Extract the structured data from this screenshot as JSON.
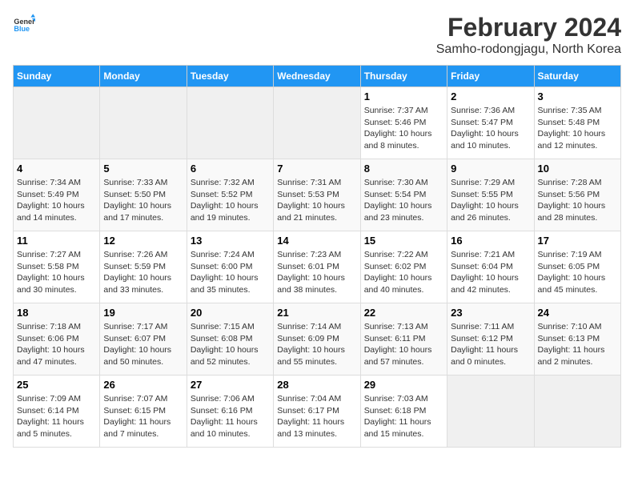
{
  "logo": {
    "text_general": "General",
    "text_blue": "Blue"
  },
  "title": "February 2024",
  "subtitle": "Samho-rodongjagu, North Korea",
  "days_of_week": [
    "Sunday",
    "Monday",
    "Tuesday",
    "Wednesday",
    "Thursday",
    "Friday",
    "Saturday"
  ],
  "weeks": [
    [
      {
        "day": "",
        "content": ""
      },
      {
        "day": "",
        "content": ""
      },
      {
        "day": "",
        "content": ""
      },
      {
        "day": "",
        "content": ""
      },
      {
        "day": "1",
        "content": "Sunrise: 7:37 AM\nSunset: 5:46 PM\nDaylight: 10 hours and 8 minutes."
      },
      {
        "day": "2",
        "content": "Sunrise: 7:36 AM\nSunset: 5:47 PM\nDaylight: 10 hours and 10 minutes."
      },
      {
        "day": "3",
        "content": "Sunrise: 7:35 AM\nSunset: 5:48 PM\nDaylight: 10 hours and 12 minutes."
      }
    ],
    [
      {
        "day": "4",
        "content": "Sunrise: 7:34 AM\nSunset: 5:49 PM\nDaylight: 10 hours and 14 minutes."
      },
      {
        "day": "5",
        "content": "Sunrise: 7:33 AM\nSunset: 5:50 PM\nDaylight: 10 hours and 17 minutes."
      },
      {
        "day": "6",
        "content": "Sunrise: 7:32 AM\nSunset: 5:52 PM\nDaylight: 10 hours and 19 minutes."
      },
      {
        "day": "7",
        "content": "Sunrise: 7:31 AM\nSunset: 5:53 PM\nDaylight: 10 hours and 21 minutes."
      },
      {
        "day": "8",
        "content": "Sunrise: 7:30 AM\nSunset: 5:54 PM\nDaylight: 10 hours and 23 minutes."
      },
      {
        "day": "9",
        "content": "Sunrise: 7:29 AM\nSunset: 5:55 PM\nDaylight: 10 hours and 26 minutes."
      },
      {
        "day": "10",
        "content": "Sunrise: 7:28 AM\nSunset: 5:56 PM\nDaylight: 10 hours and 28 minutes."
      }
    ],
    [
      {
        "day": "11",
        "content": "Sunrise: 7:27 AM\nSunset: 5:58 PM\nDaylight: 10 hours and 30 minutes."
      },
      {
        "day": "12",
        "content": "Sunrise: 7:26 AM\nSunset: 5:59 PM\nDaylight: 10 hours and 33 minutes."
      },
      {
        "day": "13",
        "content": "Sunrise: 7:24 AM\nSunset: 6:00 PM\nDaylight: 10 hours and 35 minutes."
      },
      {
        "day": "14",
        "content": "Sunrise: 7:23 AM\nSunset: 6:01 PM\nDaylight: 10 hours and 38 minutes."
      },
      {
        "day": "15",
        "content": "Sunrise: 7:22 AM\nSunset: 6:02 PM\nDaylight: 10 hours and 40 minutes."
      },
      {
        "day": "16",
        "content": "Sunrise: 7:21 AM\nSunset: 6:04 PM\nDaylight: 10 hours and 42 minutes."
      },
      {
        "day": "17",
        "content": "Sunrise: 7:19 AM\nSunset: 6:05 PM\nDaylight: 10 hours and 45 minutes."
      }
    ],
    [
      {
        "day": "18",
        "content": "Sunrise: 7:18 AM\nSunset: 6:06 PM\nDaylight: 10 hours and 47 minutes."
      },
      {
        "day": "19",
        "content": "Sunrise: 7:17 AM\nSunset: 6:07 PM\nDaylight: 10 hours and 50 minutes."
      },
      {
        "day": "20",
        "content": "Sunrise: 7:15 AM\nSunset: 6:08 PM\nDaylight: 10 hours and 52 minutes."
      },
      {
        "day": "21",
        "content": "Sunrise: 7:14 AM\nSunset: 6:09 PM\nDaylight: 10 hours and 55 minutes."
      },
      {
        "day": "22",
        "content": "Sunrise: 7:13 AM\nSunset: 6:11 PM\nDaylight: 10 hours and 57 minutes."
      },
      {
        "day": "23",
        "content": "Sunrise: 7:11 AM\nSunset: 6:12 PM\nDaylight: 11 hours and 0 minutes."
      },
      {
        "day": "24",
        "content": "Sunrise: 7:10 AM\nSunset: 6:13 PM\nDaylight: 11 hours and 2 minutes."
      }
    ],
    [
      {
        "day": "25",
        "content": "Sunrise: 7:09 AM\nSunset: 6:14 PM\nDaylight: 11 hours and 5 minutes."
      },
      {
        "day": "26",
        "content": "Sunrise: 7:07 AM\nSunset: 6:15 PM\nDaylight: 11 hours and 7 minutes."
      },
      {
        "day": "27",
        "content": "Sunrise: 7:06 AM\nSunset: 6:16 PM\nDaylight: 11 hours and 10 minutes."
      },
      {
        "day": "28",
        "content": "Sunrise: 7:04 AM\nSunset: 6:17 PM\nDaylight: 11 hours and 13 minutes."
      },
      {
        "day": "29",
        "content": "Sunrise: 7:03 AM\nSunset: 6:18 PM\nDaylight: 11 hours and 15 minutes."
      },
      {
        "day": "",
        "content": ""
      },
      {
        "day": "",
        "content": ""
      }
    ]
  ]
}
